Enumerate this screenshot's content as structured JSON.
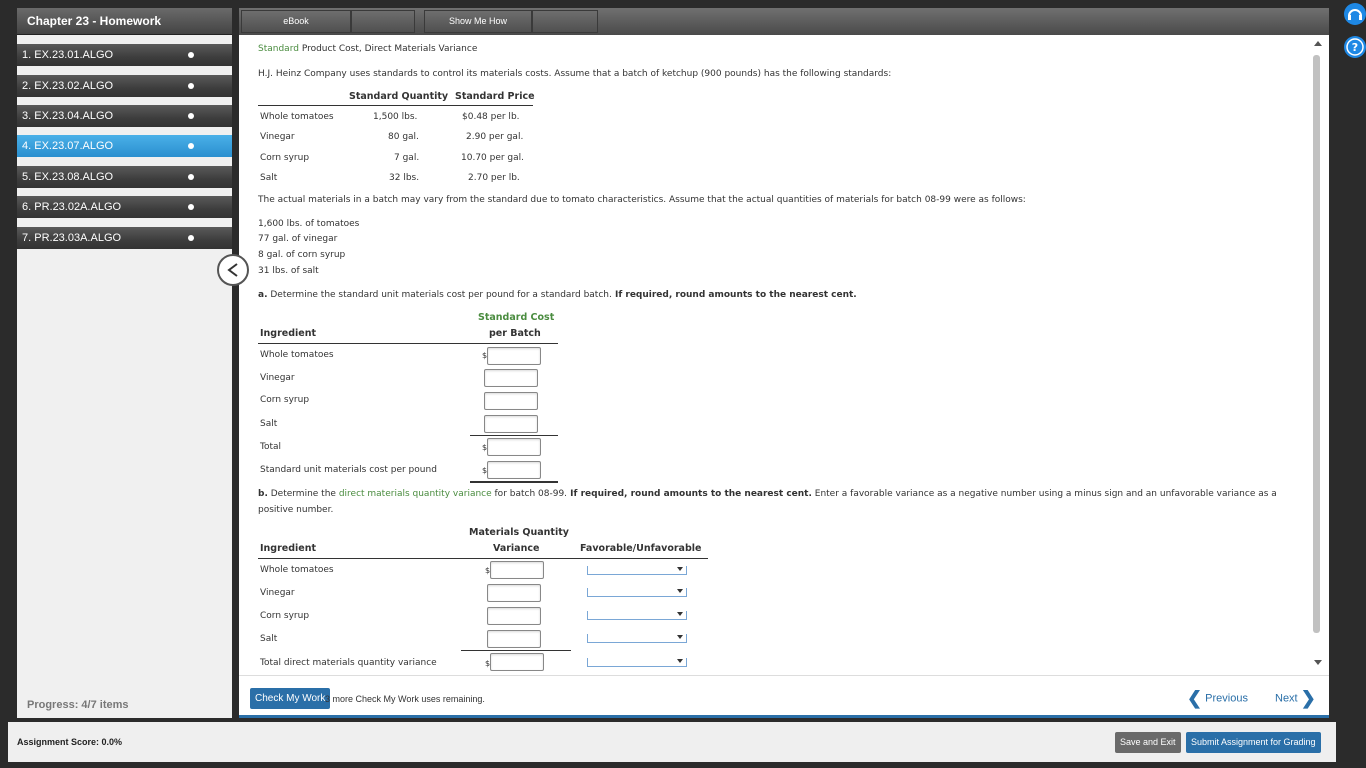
{
  "sidebar": {
    "title": "Chapter 23 - Homework",
    "items": [
      {
        "label": "1. EX.23.01.ALGO"
      },
      {
        "label": "2. EX.23.02.ALGO"
      },
      {
        "label": "3. EX.23.04.ALGO"
      },
      {
        "label": "4. EX.23.07.ALGO"
      },
      {
        "label": "5. EX.23.08.ALGO"
      },
      {
        "label": "6. PR.23.02A.ALGO"
      },
      {
        "label": "7. PR.23.03A.ALGO"
      }
    ],
    "active_index": 3,
    "progress": "Progress: 4/7 items"
  },
  "tabs": {
    "ebook": "eBook",
    "show_me_how": "Show Me How"
  },
  "problem": {
    "title_link": "Standard",
    "title_rest": " Product Cost, Direct Materials Variance",
    "intro": "H.J. Heinz Company uses standards to control its materials costs. Assume that a batch of ketchup (900 pounds) has the following standards:",
    "std_table": {
      "headers": [
        "Standard Quantity",
        "Standard Price"
      ],
      "rows": [
        {
          "name": "Whole tomatoes",
          "qty": "1,500 lbs.",
          "price": "$0.48 per lb."
        },
        {
          "name": "Vinegar",
          "qty": "80 gal.",
          "price": "2.90 per gal."
        },
        {
          "name": "Corn syrup",
          "qty": "7 gal.",
          "price": "10.70 per gal."
        },
        {
          "name": "Salt",
          "qty": "32 lbs.",
          "price": "2.70 per lb."
        }
      ]
    },
    "actual_intro": "The actual materials in a batch may vary from the standard due to tomato characteristics. Assume that the actual quantities of materials for batch 08-99 were as follows:",
    "actual": [
      "1,600 lbs. of tomatoes",
      "77 gal. of vinegar",
      "8 gal. of corn syrup",
      "31 lbs. of salt"
    ],
    "part_a": {
      "prefix": "a.",
      "text": " Determine the standard unit materials cost per pound for a standard batch.",
      "bold": " If required, round amounts to the nearest cent.",
      "col1": "Ingredient",
      "col2_line1": "Standard Cost",
      "col2_line2": "per Batch",
      "rows": [
        "Whole tomatoes",
        "Vinegar",
        "Corn syrup",
        "Salt",
        "Total",
        "Standard unit materials cost per pound"
      ]
    },
    "part_b": {
      "prefix": "b.",
      "text1": " Determine the ",
      "link": "direct materials quantity variance",
      "text2": " for batch 08-99.",
      "bold": " If required, round amounts to the nearest cent.",
      "text3": " Enter a favorable variance as a negative number using a minus sign and an unfavorable variance as a",
      "text4": "positive number.",
      "col1": "Ingredient",
      "col2_line1": "Materials Quantity",
      "col2_line2": "Variance",
      "col3": "Favorable/Unfavorable",
      "rows": [
        "Whole tomatoes",
        "Vinegar",
        "Corn syrup",
        "Salt",
        "Total direct materials quantity variance"
      ]
    },
    "dollar": "$"
  },
  "actions": {
    "check": "Check My Work",
    "remaining": "3 more Check My Work uses remaining.",
    "previous": "Previous",
    "next": "Next"
  },
  "footer": {
    "score": "Assignment Score:   0.0%",
    "save_exit": "Save and Exit",
    "submit": "Submit Assignment for Grading"
  },
  "colors": {
    "accent": "#2a6fa8",
    "active_nav": "#3aa0dc",
    "link_green": "#4a8c3f"
  }
}
